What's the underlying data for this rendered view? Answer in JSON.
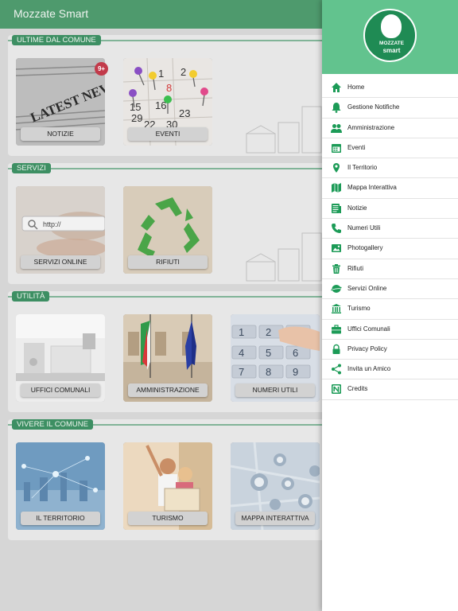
{
  "app": {
    "title": "Mozzate Smart"
  },
  "sections": [
    {
      "label": "ULTIME DAL COMUNE",
      "tiles": [
        {
          "label": "NOTIZIE",
          "badge": "9+"
        },
        {
          "label": "EVENTI"
        }
      ]
    },
    {
      "label": "SERVIZI",
      "tiles": [
        {
          "label": "SERVIZI ONLINE",
          "search_text": "http://"
        },
        {
          "label": "RIFIUTI"
        }
      ]
    },
    {
      "label": "UTILITÀ",
      "tiles": [
        {
          "label": "UFFICI COMUNALI"
        },
        {
          "label": "AMMINISTRAZIONE"
        },
        {
          "label": "NUMERI UTILI"
        }
      ]
    },
    {
      "label": "VIVERE IL COMUNE",
      "tiles": [
        {
          "label": "IL TERRITORIO"
        },
        {
          "label": "TURISMO"
        },
        {
          "label": "MAPPA INTERATTIVA"
        }
      ]
    }
  ],
  "art": {
    "news_headline": "LATEST NEWS",
    "calendar_numbers": [
      "1",
      "2",
      "8",
      "15",
      "16",
      "22",
      "23",
      "29",
      "30"
    ],
    "keypad": [
      "1",
      "2",
      "3",
      "4",
      "5",
      "6",
      "7",
      "8",
      "9"
    ]
  },
  "drawer": {
    "logo": {
      "name": "MOZZATE",
      "sub": "smart"
    },
    "items": [
      {
        "label": "Home",
        "icon": "home-icon"
      },
      {
        "label": "Gestione Notifiche",
        "icon": "bell-icon"
      },
      {
        "label": "Amministrazione",
        "icon": "people-icon"
      },
      {
        "label": "Eventi",
        "icon": "calendar-icon"
      },
      {
        "label": "Il Territorio",
        "icon": "map-pin-icon"
      },
      {
        "label": "Mappa Interattiva",
        "icon": "map-icon"
      },
      {
        "label": "Notizie",
        "icon": "news-icon"
      },
      {
        "label": "Numeri Utili",
        "icon": "phone-icon"
      },
      {
        "label": "Photogallery",
        "icon": "photo-icon"
      },
      {
        "label": "Rifiuti",
        "icon": "trash-icon"
      },
      {
        "label": "Servizi Online",
        "icon": "globe-icon"
      },
      {
        "label": "Turismo",
        "icon": "museum-icon"
      },
      {
        "label": "Uffici Comunali",
        "icon": "briefcase-icon"
      },
      {
        "label": "Privacy Policy",
        "icon": "lock-icon"
      },
      {
        "label": "Invita un Amico",
        "icon": "share-icon"
      },
      {
        "label": "Credits",
        "icon": "credits-icon"
      }
    ]
  },
  "colors": {
    "primary": "#4e9a6d",
    "accent": "#62c38e",
    "icon_green": "#1c9b57",
    "badge": "#c23a4a"
  }
}
